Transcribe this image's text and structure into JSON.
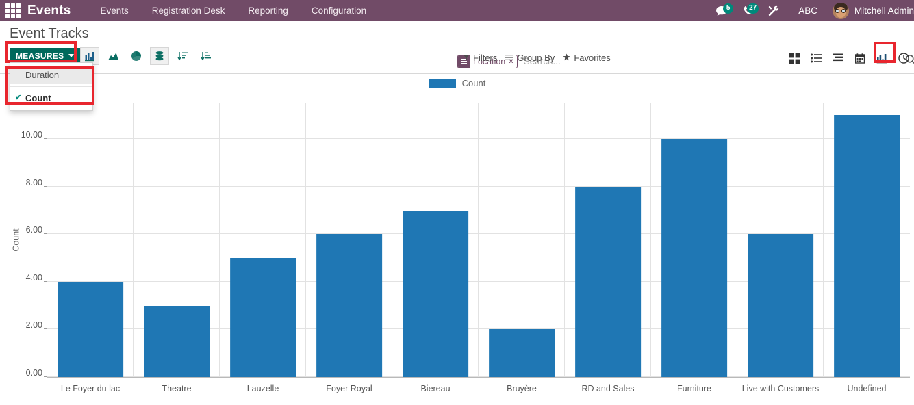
{
  "navbar": {
    "apps_icon": "apps-grid-icon",
    "brand": "Events",
    "menus": [
      "Events",
      "Registration Desk",
      "Reporting",
      "Configuration"
    ],
    "messages_icon": "messages-icon",
    "messages_count": "5",
    "phone_icon": "phone-icon",
    "activity_icon": "activity-clock-icon",
    "activity_count": "27",
    "tools_icon": "tools-icon",
    "debug_label": "ABC",
    "avatar": "user-avatar",
    "username": "Mitchell Admin",
    "background_color": "#714B67"
  },
  "control_panel": {
    "page_title": "Event Tracks",
    "measures": {
      "label": "MEASURES",
      "color": "#00695C",
      "options": [
        {
          "label": "Duration",
          "checked": false,
          "hovered": true
        },
        {
          "label": "Count",
          "checked": true,
          "hovered": false
        }
      ],
      "check_glyph": "✔"
    },
    "graph_buttons": [
      {
        "name": "bar-chart-button",
        "active": true
      },
      {
        "name": "line-chart-button",
        "active": false
      },
      {
        "name": "pie-chart-button",
        "active": false
      },
      {
        "name": "stacked-button",
        "active": true
      },
      {
        "name": "sort-ascending-button",
        "active": false
      },
      {
        "name": "sort-descending-button",
        "active": false
      }
    ],
    "search": {
      "facet_label": "Location",
      "facet_remove": "×",
      "placeholder": "Search..."
    },
    "filters": [
      {
        "label": "Filters",
        "icon": "funnel-icon"
      },
      {
        "label": "Group By",
        "icon": "bars-icon"
      },
      {
        "label": "Favorites",
        "icon": "star-icon"
      }
    ],
    "views": [
      {
        "name": "kanban-view-button",
        "selected": false
      },
      {
        "name": "list-view-button",
        "selected": false
      },
      {
        "name": "pivot-view-button",
        "selected": false
      },
      {
        "name": "calendar-view-button",
        "selected": false
      },
      {
        "name": "graph-view-button",
        "selected": true
      },
      {
        "name": "activity-view-button",
        "selected": false
      }
    ],
    "highlight_color": "#e8262e"
  },
  "chart_data": {
    "type": "bar",
    "title": "",
    "xlabel": "",
    "ylabel": "Count",
    "ylim": [
      0,
      11.5
    ],
    "yticks": [
      0,
      2,
      4,
      6,
      8,
      10
    ],
    "ytick_labels": [
      "0.00",
      "2.00",
      "4.00",
      "6.00",
      "8.00",
      "10.00"
    ],
    "grid": true,
    "legend": [
      {
        "name": "Count",
        "color": "#1f77b4"
      }
    ],
    "legend_position": "top-center",
    "categories": [
      "Le Foyer du lac",
      "Theatre",
      "Lauzelle",
      "Foyer Royal",
      "Biereau",
      "Bruyère",
      "RD and Sales",
      "Furniture",
      "Live with Customers",
      "Undefined"
    ],
    "values": [
      4,
      3,
      5,
      6,
      7,
      2,
      8,
      10,
      6,
      11
    ],
    "bar_color": "#1f77b4"
  }
}
